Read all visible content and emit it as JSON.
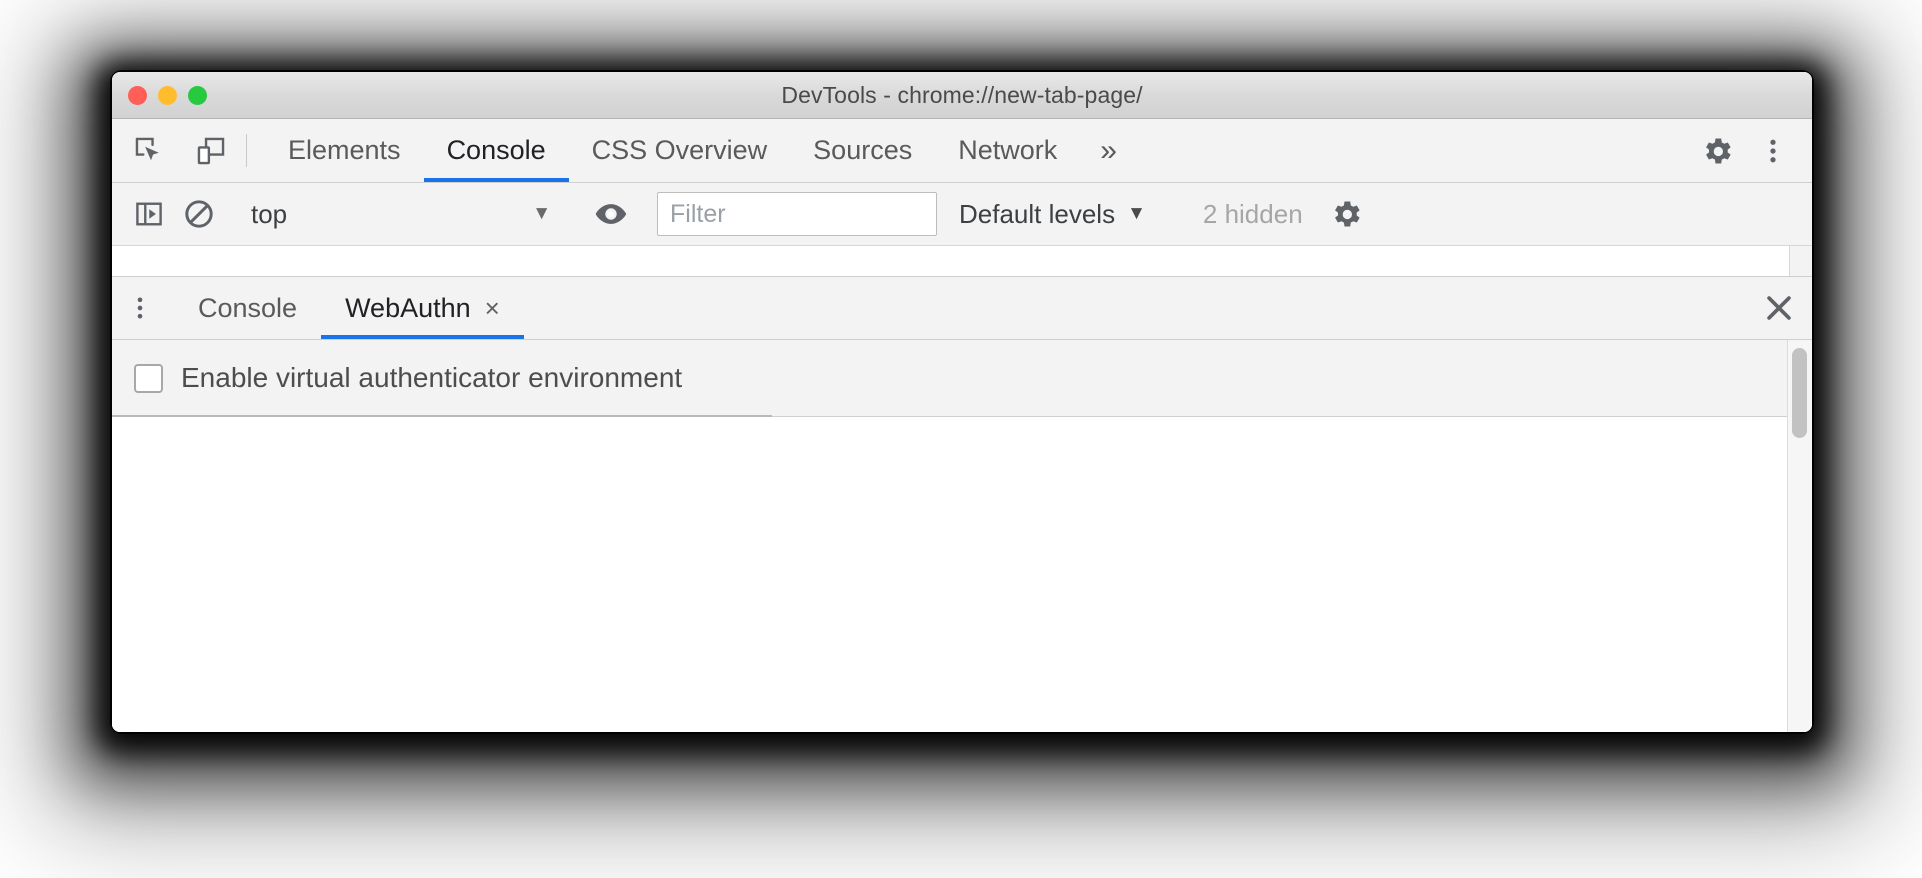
{
  "window": {
    "title": "DevTools - chrome://new-tab-page/",
    "traffic_lights": {
      "close_label": "close",
      "minimize_label": "minimize",
      "maximize_label": "maximize",
      "close_color": "#ff5f56",
      "minimize_color": "#ffbd2e",
      "maximize_color": "#27c93f"
    }
  },
  "toolbar": {
    "inspect_icon": "inspect-element-icon",
    "device_toggle_icon": "device-toolbar-icon",
    "settings_icon": "gear-icon",
    "more_options_icon": "kebab-menu-icon"
  },
  "panel_tabs": {
    "items": [
      {
        "label": "Elements",
        "active": false
      },
      {
        "label": "Console",
        "active": true
      },
      {
        "label": "CSS Overview",
        "active": false
      },
      {
        "label": "Sources",
        "active": false
      },
      {
        "label": "Network",
        "active": false
      }
    ],
    "more_label": "»",
    "active_underline_color": "#1a73e8"
  },
  "console_toolbar": {
    "sidebar_toggle_icon": "console-sidebar-icon",
    "clear_console_icon": "clear-console-icon",
    "context_selector": {
      "value": "top",
      "caret": "▼"
    },
    "live_expression_icon": "eye-icon",
    "filter": {
      "value": "",
      "placeholder": "Filter"
    },
    "log_levels": {
      "label": "Default levels",
      "caret": "▼"
    },
    "hidden_messages": "2 hidden",
    "settings_icon": "gear-icon"
  },
  "drawer": {
    "more_tools_icon": "kebab-menu-icon",
    "tabs": [
      {
        "label": "Console",
        "active": false,
        "closable": false
      },
      {
        "label": "WebAuthn",
        "active": true,
        "closable": true,
        "close_glyph": "×"
      }
    ],
    "close_icon": "close-icon",
    "close_glyph": "✕",
    "active_underline_color": "#1a73e8"
  },
  "webauthn": {
    "enable_checkbox": {
      "label": "Enable virtual authenticator environment",
      "checked": false
    }
  },
  "colors": {
    "accent": "#1a73e8",
    "toolbar_bg": "#f3f3f3",
    "panel_bg": "#ffffff",
    "text": "#3c4043",
    "muted_text": "#a6a6a6",
    "border": "#cfcfcf"
  }
}
